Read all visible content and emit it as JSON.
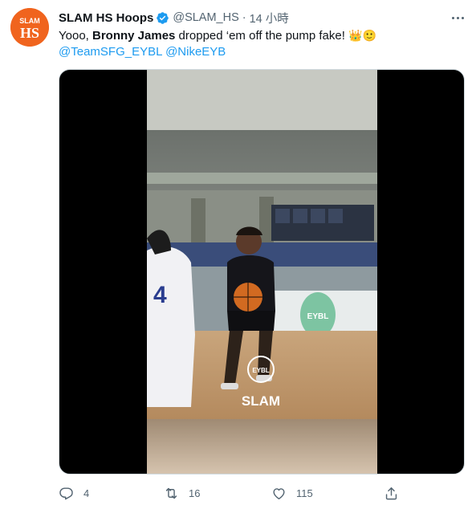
{
  "account": {
    "display_name": "SLAM HS Hoops",
    "handle": "@SLAM_HS",
    "separator": "·",
    "time": "14 小時",
    "avatar_text": {
      "top": "SLAM",
      "bottom": "HS"
    },
    "verified": true,
    "brand_color": "#f0641e"
  },
  "tweet": {
    "text_before": "Yooo, ",
    "text_bold": "Bronny James",
    "text_after": " dropped ‘em off the pump fake! ",
    "emojis": [
      "👑",
      "🙂"
    ],
    "mentions": [
      "@TeamSFG_EYBL",
      "@NikeEYB"
    ]
  },
  "media": {
    "type": "video",
    "overlay_logo_top": "EYBL",
    "overlay_logo_bottom": "SLAM",
    "jersey_number": "4",
    "court_logo": "EYBL"
  },
  "actions": {
    "reply_count": "4",
    "retweet_count": "16",
    "like_count": "115",
    "icons": [
      "reply-icon",
      "retweet-icon",
      "like-icon",
      "share-icon"
    ]
  },
  "colors": {
    "link": "#1d9bf0",
    "secondary_text": "#536471",
    "verified": "#1d9bf0"
  }
}
